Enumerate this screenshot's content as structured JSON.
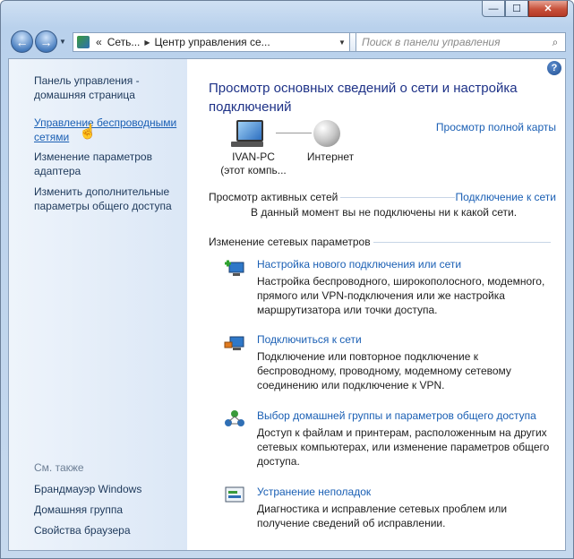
{
  "window": {
    "buttons": {
      "minimize": "—",
      "maximize": "☐",
      "close": "✕"
    }
  },
  "navbar": {
    "address": {
      "prefix": "«",
      "seg1": "Сеть...",
      "seg2": "Центр управления се..."
    },
    "search_placeholder": "Поиск в панели управления"
  },
  "sidebar": {
    "items": [
      "Панель управления - домашняя страница",
      "Управление беспроводными сетями",
      "Изменение параметров адаптера",
      "Изменить дополнительные параметры общего доступа"
    ],
    "see_also_title": "См. также",
    "see_also": [
      "Брандмауэр Windows",
      "Домашняя группа",
      "Свойства браузера"
    ]
  },
  "main": {
    "title": "Просмотр основных сведений о сети и настройка подключений",
    "full_map": "Просмотр полной карты",
    "pc_name": "IVAN-PC",
    "pc_sub": "(этот компь...",
    "internet": "Интернет",
    "active_title": "Просмотр активных сетей",
    "connect_link": "Подключение к сети",
    "no_networks": "В данный момент вы не подключены ни к какой сети.",
    "change_title": "Изменение сетевых параметров",
    "tasks": [
      {
        "title": "Настройка нового подключения или сети",
        "desc": "Настройка беспроводного, широкополосного, модемного, прямого или VPN-подключения или же настройка маршрутизатора или точки доступа."
      },
      {
        "title": "Подключиться к сети",
        "desc": "Подключение или повторное подключение к беспроводному, проводному, модемному сетевому соединению или подключение к VPN."
      },
      {
        "title": "Выбор домашней группы и параметров общего доступа",
        "desc": "Доступ к файлам и принтерам, расположенным на других сетевых компьютерах, или изменение параметров общего доступа."
      },
      {
        "title": "Устранение неполадок",
        "desc": "Диагностика и исправление сетевых проблем или получение сведений об исправлении."
      }
    ]
  }
}
